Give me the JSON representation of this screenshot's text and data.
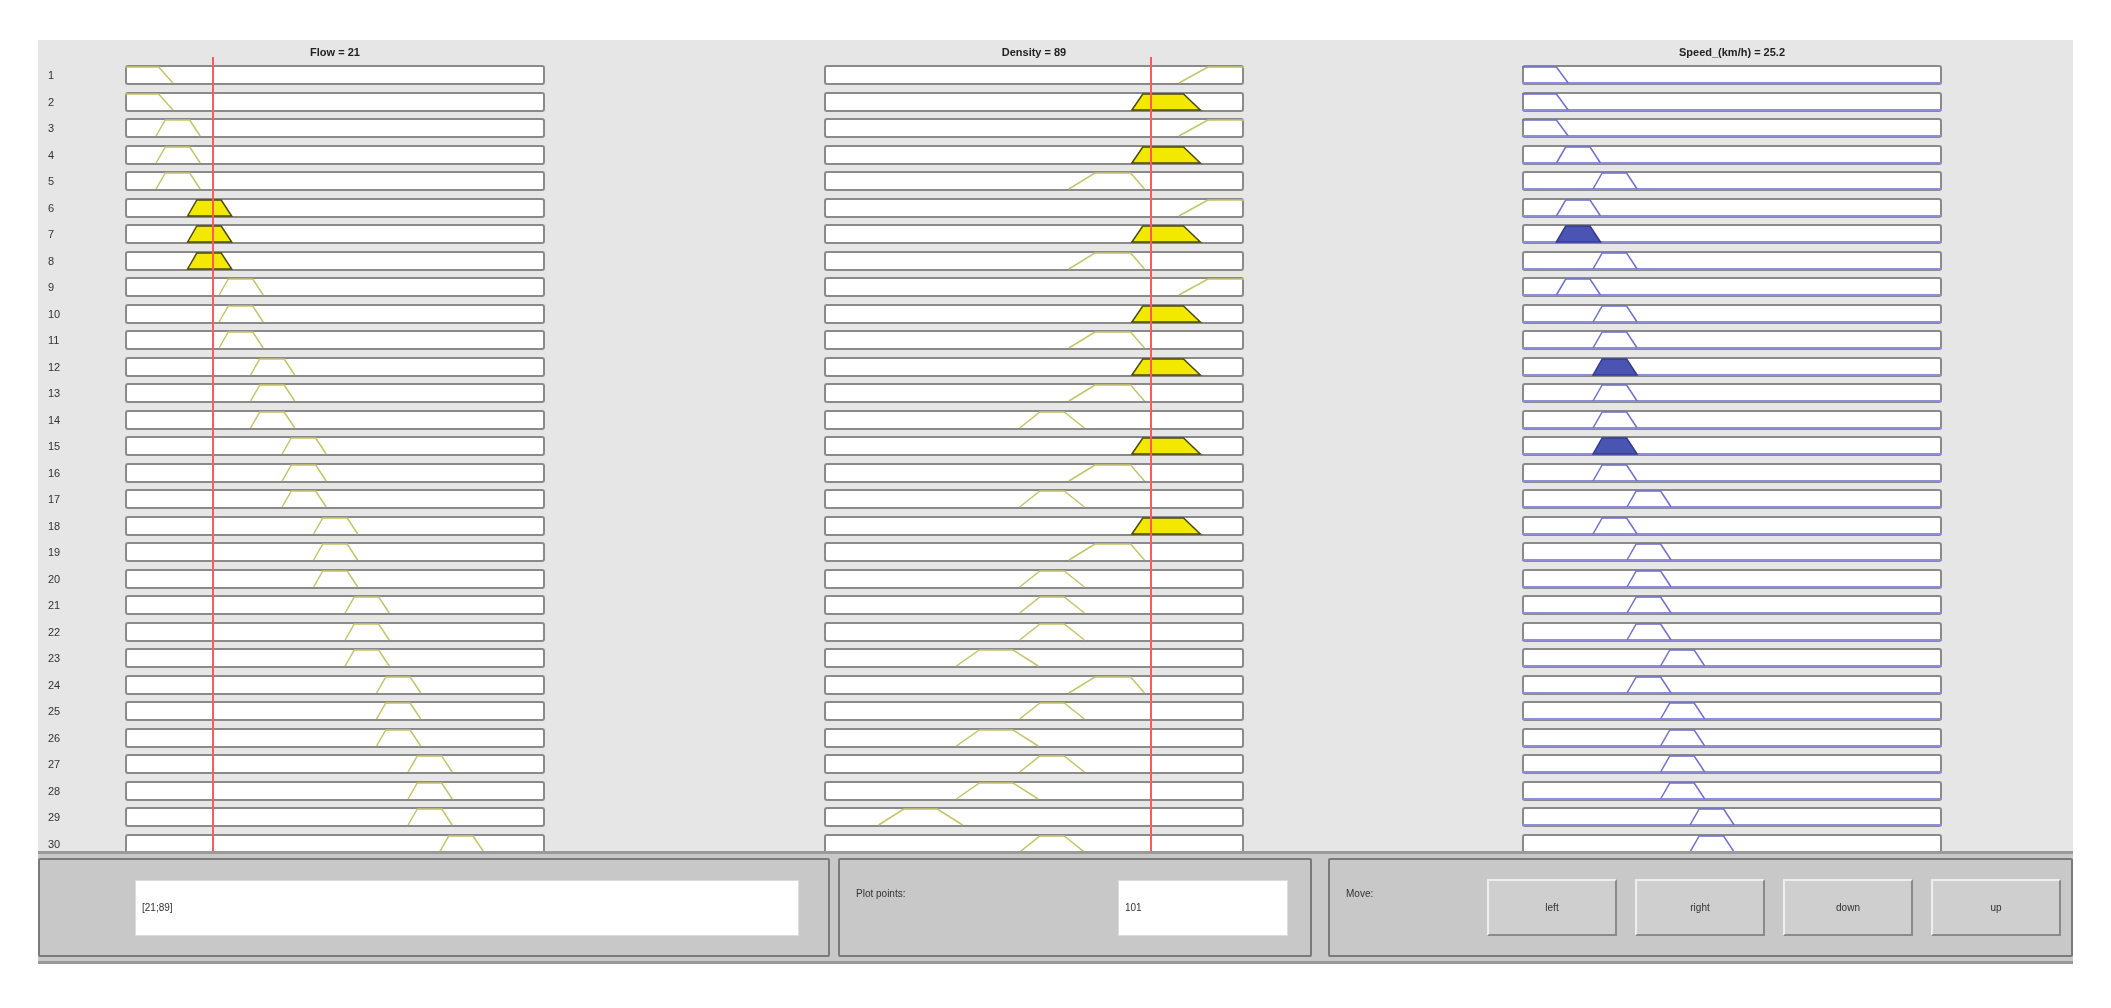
{
  "columns": [
    {
      "title": "Flow = 21",
      "kind": "input",
      "level": 0.21
    },
    {
      "title": "Density = 89",
      "kind": "input",
      "level": 0.778
    },
    {
      "title": "Speed_(km/h) = 25.2",
      "kind": "output"
    }
  ],
  "rules": [
    {
      "number": "1",
      "cells": [
        {
          "fired": false
        },
        {
          "fired": false
        },
        {
          "fired": false
        }
      ]
    },
    {
      "number": "2",
      "cells": [
        {
          "fired": false
        },
        {
          "fired": true
        },
        {
          "fired": false
        }
      ]
    },
    {
      "number": "3",
      "cells": [
        {
          "fired": false
        },
        {
          "fired": false
        },
        {
          "fired": false
        }
      ]
    },
    {
      "number": "4",
      "cells": [
        {
          "fired": false
        },
        {
          "fired": true
        },
        {
          "fired": false
        }
      ]
    },
    {
      "number": "5",
      "cells": [
        {
          "fired": false
        },
        {
          "fired": false
        },
        {
          "fired": false
        }
      ]
    },
    {
      "number": "6",
      "cells": [
        {
          "fired": true
        },
        {
          "fired": false
        },
        {
          "fired": false
        }
      ]
    },
    {
      "number": "7",
      "cells": [
        {
          "fired": true
        },
        {
          "fired": true
        },
        {
          "fired": true
        }
      ]
    },
    {
      "number": "8",
      "cells": [
        {
          "fired": true
        },
        {
          "fired": false
        },
        {
          "fired": false
        }
      ]
    },
    {
      "number": "9",
      "cells": [
        {
          "fired": false
        },
        {
          "fired": false
        },
        {
          "fired": false
        }
      ]
    },
    {
      "number": "10",
      "cells": [
        {
          "fired": false
        },
        {
          "fired": true
        },
        {
          "fired": false
        }
      ]
    },
    {
      "number": "11",
      "cells": [
        {
          "fired": false
        },
        {
          "fired": false
        },
        {
          "fired": false
        }
      ]
    },
    {
      "number": "12",
      "cells": [
        {
          "fired": false
        },
        {
          "fired": true
        },
        {
          "fired": true
        }
      ]
    },
    {
      "number": "13",
      "cells": [
        {
          "fired": false
        },
        {
          "fired": false
        },
        {
          "fired": false
        }
      ]
    },
    {
      "number": "14",
      "cells": [
        {
          "fired": false
        },
        {
          "fired": false
        },
        {
          "fired": false
        }
      ]
    },
    {
      "number": "15",
      "cells": [
        {
          "fired": false
        },
        {
          "fired": true
        },
        {
          "fired": true
        }
      ]
    },
    {
      "number": "16",
      "cells": [
        {
          "fired": false
        },
        {
          "fired": false
        },
        {
          "fired": false
        }
      ]
    },
    {
      "number": "17",
      "cells": [
        {
          "fired": false
        },
        {
          "fired": false
        },
        {
          "fired": false
        }
      ]
    },
    {
      "number": "18",
      "cells": [
        {
          "fired": false
        },
        {
          "fired": true
        },
        {
          "fired": false
        }
      ]
    },
    {
      "number": "19",
      "cells": [
        {
          "fired": false
        },
        {
          "fired": false
        },
        {
          "fired": false
        }
      ]
    },
    {
      "number": "20",
      "cells": [
        {
          "fired": false
        },
        {
          "fired": false
        },
        {
          "fired": false
        }
      ]
    },
    {
      "number": "21",
      "cells": [
        {
          "fired": false
        },
        {
          "fired": false
        },
        {
          "fired": false
        }
      ]
    },
    {
      "number": "22",
      "cells": [
        {
          "fired": false
        },
        {
          "fired": false
        },
        {
          "fired": false
        }
      ]
    },
    {
      "number": "23",
      "cells": [
        {
          "fired": false
        },
        {
          "fired": false
        },
        {
          "fired": false
        }
      ]
    },
    {
      "number": "24",
      "cells": [
        {
          "fired": false
        },
        {
          "fired": false
        },
        {
          "fired": false
        }
      ]
    },
    {
      "number": "25",
      "cells": [
        {
          "fired": false
        },
        {
          "fired": false
        },
        {
          "fired": false
        }
      ]
    },
    {
      "number": "26",
      "cells": [
        {
          "fired": false
        },
        {
          "fired": false
        },
        {
          "fired": false
        }
      ]
    },
    {
      "number": "27",
      "cells": [
        {
          "fired": false
        },
        {
          "fired": false
        },
        {
          "fired": false
        }
      ]
    },
    {
      "number": "28",
      "cells": [
        {
          "fired": false
        },
        {
          "fired": false
        },
        {
          "fired": false
        }
      ]
    },
    {
      "number": "29",
      "cells": [
        {
          "fired": false
        },
        {
          "fired": false
        },
        {
          "fired": false
        }
      ]
    },
    {
      "number": "30",
      "cells": [
        {
          "fired": false
        },
        {
          "fired": false
        },
        {
          "fired": false
        }
      ]
    }
  ],
  "input_field": {
    "value": "[21;89]"
  },
  "plot_points": {
    "label": "Plot points:",
    "value": "101"
  },
  "move": {
    "label": "Move:",
    "buttons": [
      "left",
      "right",
      "down",
      "up"
    ]
  }
}
